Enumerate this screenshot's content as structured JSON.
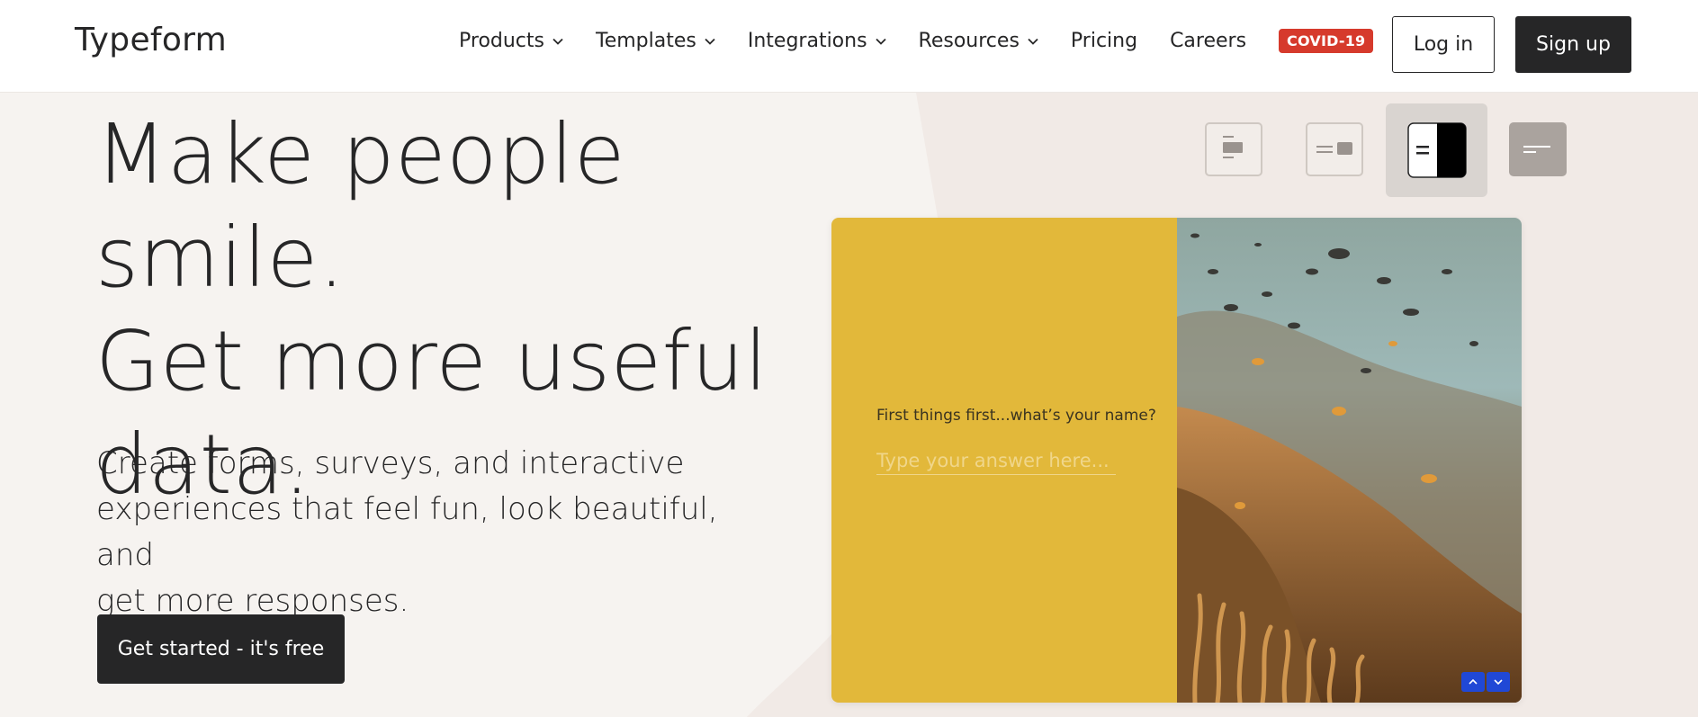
{
  "header": {
    "logo": "Typeform",
    "nav": [
      {
        "label": "Products",
        "dropdown": true
      },
      {
        "label": "Templates",
        "dropdown": true
      },
      {
        "label": "Integrations",
        "dropdown": true
      },
      {
        "label": "Resources",
        "dropdown": true
      },
      {
        "label": "Pricing",
        "dropdown": false
      },
      {
        "label": "Careers",
        "dropdown": false
      }
    ],
    "badge": "COVID-19",
    "login": "Log in",
    "signup": "Sign up"
  },
  "hero": {
    "headline_lines": [
      "Make people smile.",
      "Get more useful",
      "data."
    ],
    "subhead_lines": [
      "Create forms, surveys, and interactive",
      "experiences that feel fun, look beautiful, and",
      "get more responses."
    ],
    "cta": "Get started - it's free"
  },
  "preview": {
    "question": "First things first...what’s your name?",
    "placeholder": "Type your answer here..."
  },
  "colors": {
    "accent_yellow": "#e2b83a",
    "dark": "#262627",
    "covid_red": "#d63a2c",
    "nav_blue": "#2048d6"
  }
}
